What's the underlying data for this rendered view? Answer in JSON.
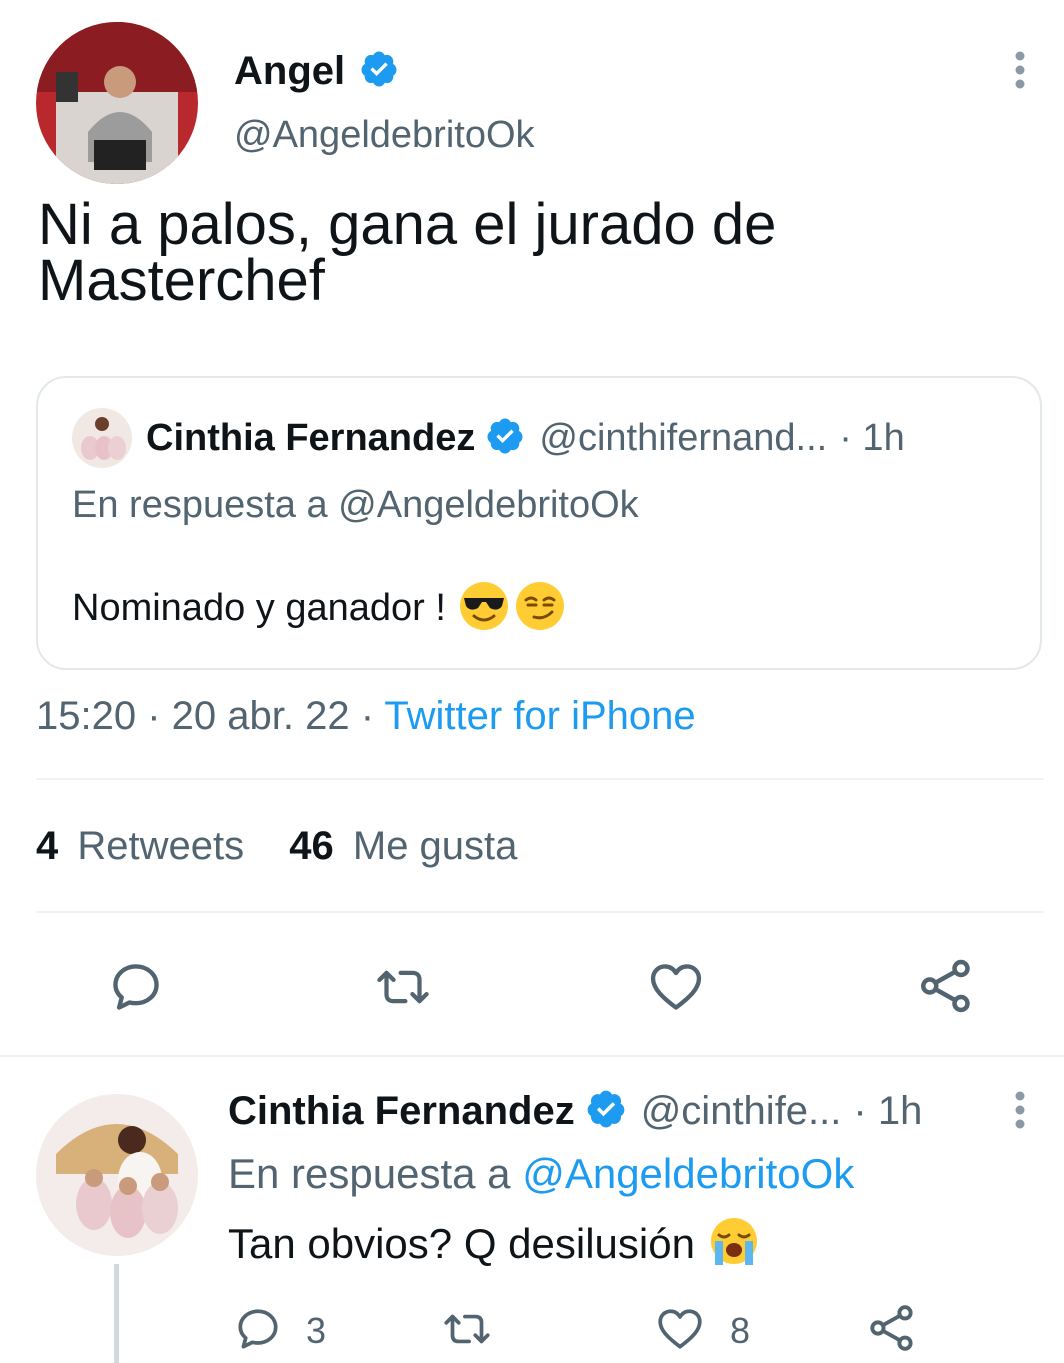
{
  "main_tweet": {
    "author_name": "Angel",
    "author_handle": "@AngeldebritoOk",
    "text_line1": "Ni a palos, gana el jurado de",
    "text_line2": "Masterchef",
    "timestamp": "15:20 · 20 abr. 22 · ",
    "source": "Twitter for iPhone",
    "retweets_count": "4",
    "retweets_label": "Retweets",
    "likes_count": "46",
    "likes_label": "Me gusta"
  },
  "quoted_tweet": {
    "author_name": "Cinthia Fernandez",
    "author_handle": "@cinthifernand...",
    "time": "· 1h",
    "reply_prefix": "En respuesta a @AngeldebritoOk",
    "text": "Nominado y ganador !",
    "emojis": [
      "sunglasses-face",
      "smirking-face"
    ]
  },
  "reply_tweet": {
    "author_name": "Cinthia Fernandez",
    "author_handle": "@cinthife...",
    "time": "· 1h",
    "reply_prefix": "En respuesta a ",
    "reply_to": "@AngeldebritoOk",
    "text": "Tan obvios? Q desilusión",
    "emoji": "loudly-crying-face",
    "reply_count": "3",
    "like_count": "8"
  },
  "colors": {
    "verified": "#1d9bf0",
    "link": "#1d9bf0",
    "secondary_text": "#536471",
    "divider": "#eff3f4"
  }
}
